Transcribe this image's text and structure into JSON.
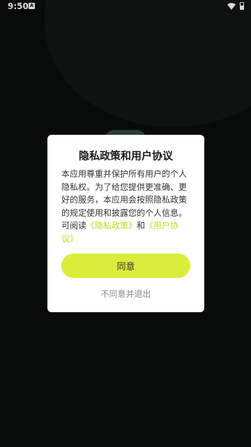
{
  "status_bar": {
    "time": "9:50",
    "notification_icon": "a-icon",
    "wifi_icon": "wifi-icon",
    "battery_icon": "battery-icon"
  },
  "dialog": {
    "title": "隐私政策和用户协议",
    "body_intro": "本应用尊重并保护所有用户的个人隐私权。为了给您提供更准确、更好的服务，本应用会按照隐私政策的规定使用和披露您的个人信息。可阅读",
    "privacy_link": "《隐私政策》",
    "conjunction": "和",
    "agreement_link": "《用户协议》",
    "agree_button": "同意",
    "decline_label": "不同意并退出"
  },
  "colors": {
    "accent": "#dcec3d",
    "link": "#c5d62a",
    "background": "#0b0d0c"
  }
}
